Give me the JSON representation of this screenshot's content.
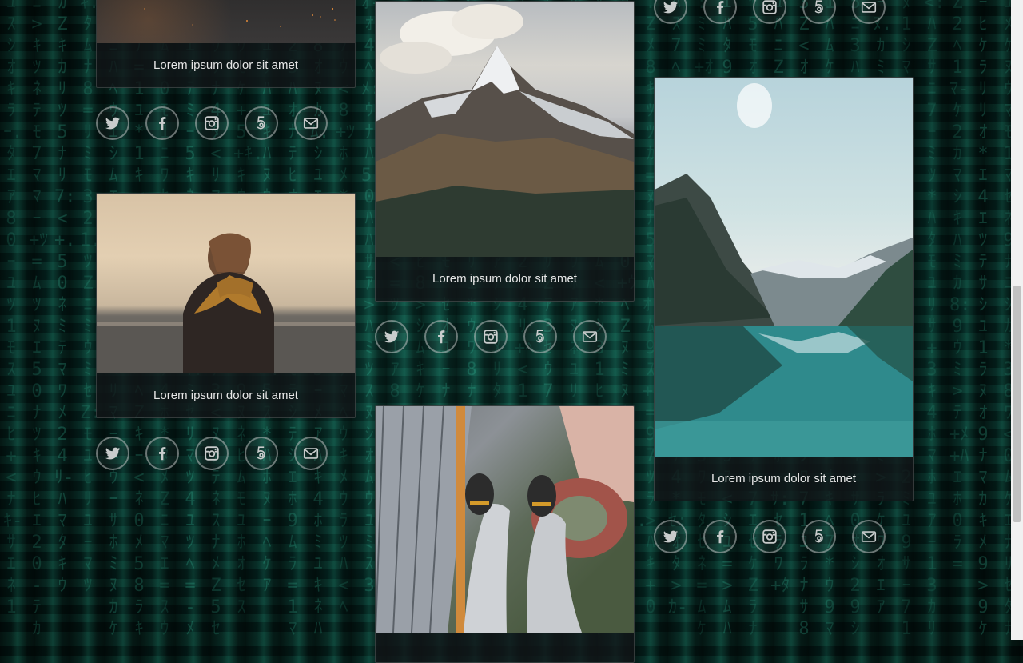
{
  "cards": [
    {
      "caption": "Lorem ipsum dolor sit amet",
      "image": "night-sky-photo"
    },
    {
      "caption": "Lorem ipsum dolor sit amet",
      "image": "woman-at-sea-photo"
    },
    {
      "caption": "Lorem ipsum dolor sit amet",
      "image": "mountain-peak-photo"
    },
    {
      "caption": "",
      "image": "city-feet-photo"
    },
    {
      "caption": "Lorem ipsum dolor sit amet",
      "image": "lake-mountains-photo"
    }
  ],
  "social_icons": [
    "twitter-icon",
    "facebook-icon",
    "instagram-icon",
    "500px-icon",
    "mail-icon"
  ],
  "colors": {
    "background": "#062a26",
    "matrix_glyph": "#46dcb4",
    "card_bg": "#121618",
    "caption_text": "#e6e6e6",
    "icon_stroke": "#b9bebe"
  }
}
